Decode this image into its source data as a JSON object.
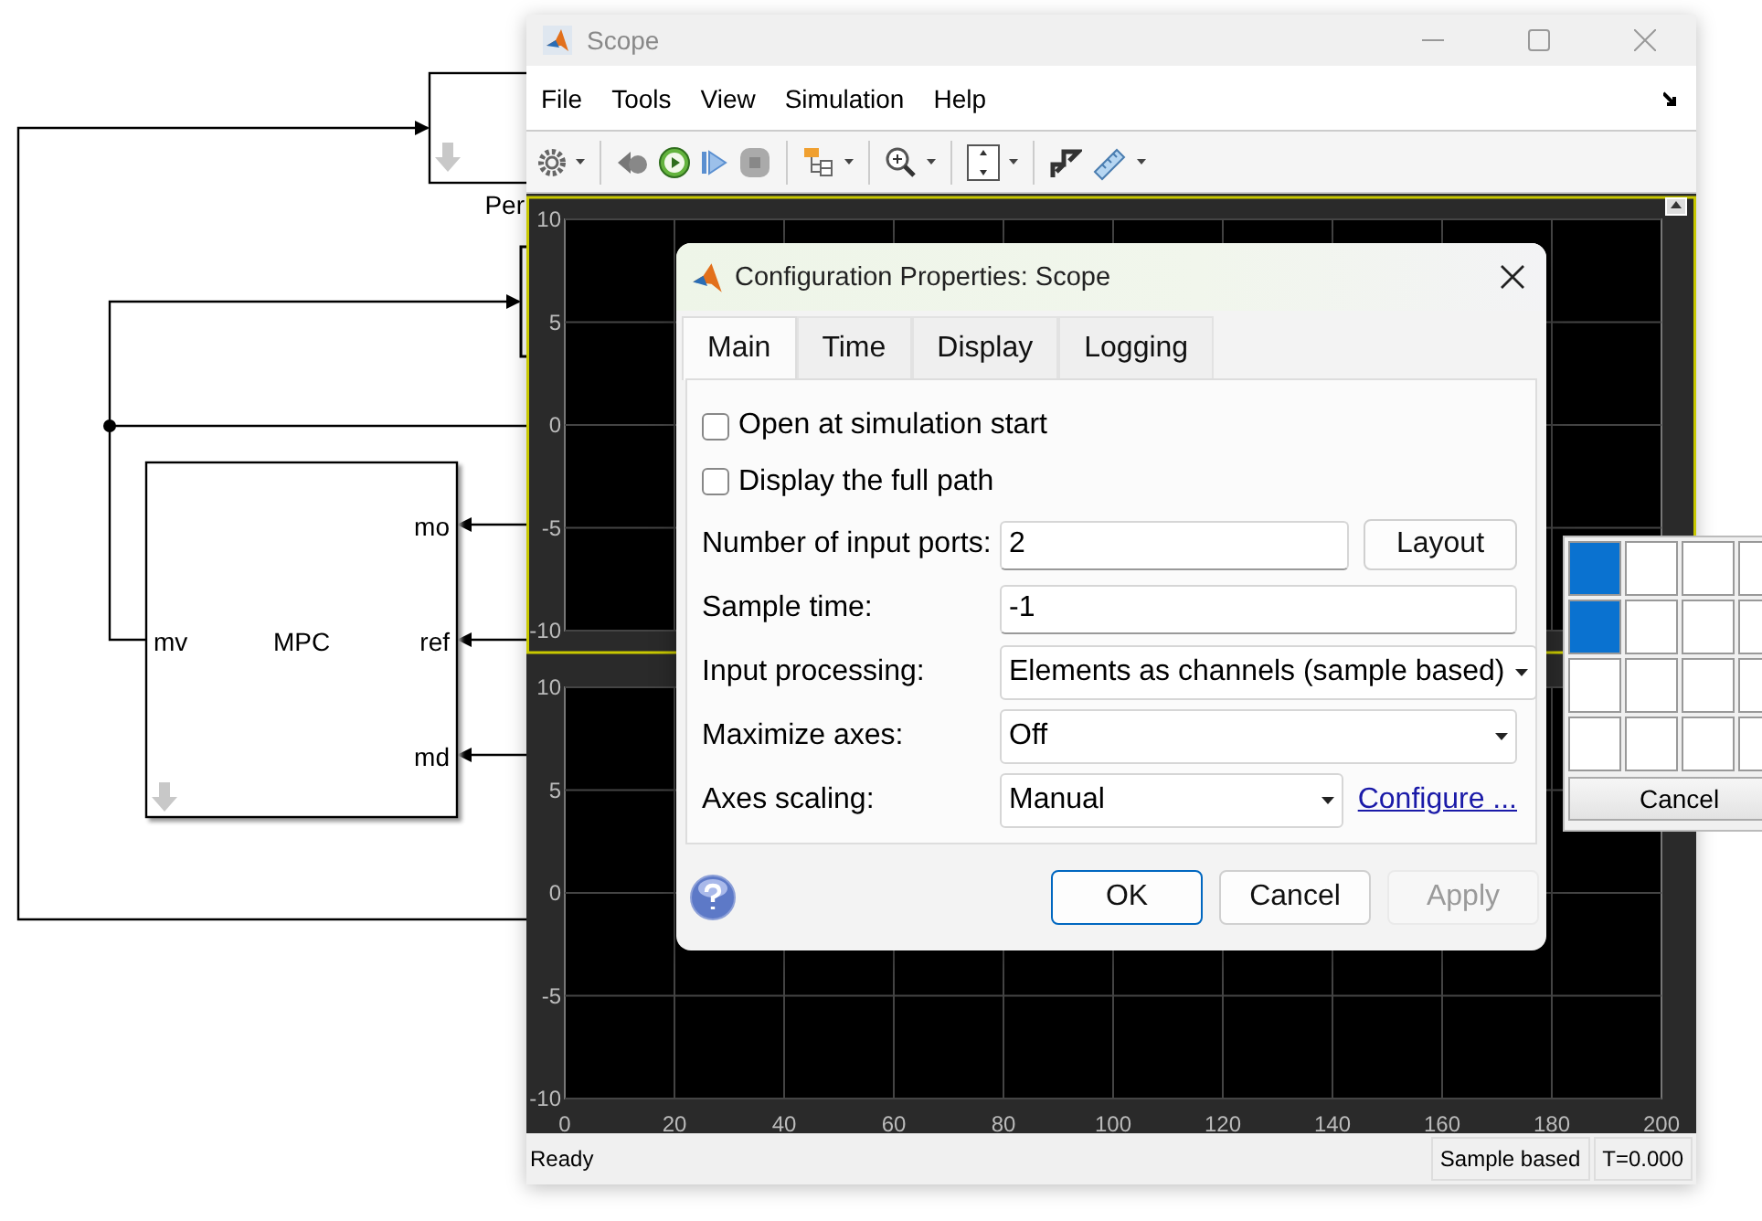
{
  "diagram": {
    "top_block_label": "Per",
    "mpc_block": {
      "name": "MPC",
      "left_ports": [
        "mv"
      ],
      "right_ports": [
        "mo",
        "ref",
        "md"
      ]
    }
  },
  "scope_window": {
    "title": "Scope",
    "menu": [
      "File",
      "Tools",
      "View",
      "Simulation",
      "Help"
    ],
    "axes": [
      {
        "selected": true,
        "yticks": [
          "10",
          "5",
          "0",
          "-5",
          "-10"
        ]
      },
      {
        "selected": false,
        "yticks": [
          "10",
          "5",
          "0",
          "-5",
          "-10"
        ],
        "xticks": [
          "0",
          "20",
          "40",
          "60",
          "80",
          "100",
          "120",
          "140",
          "160",
          "180",
          "200"
        ]
      }
    ],
    "status_bar": {
      "text": "Ready",
      "mode": "Sample based",
      "time": "T=0.000"
    }
  },
  "dialog": {
    "title": "Configuration Properties: Scope",
    "tabs": [
      {
        "label": "Main",
        "selected": true
      },
      {
        "label": "Time",
        "selected": false
      },
      {
        "label": "Display",
        "selected": false
      },
      {
        "label": "Logging",
        "selected": false
      }
    ],
    "checkboxes": [
      {
        "label": "Open at simulation start",
        "checked": false
      },
      {
        "label": "Display the full path",
        "checked": false
      }
    ],
    "fields": [
      {
        "kind": "text_with_button",
        "label": "Number of input ports:",
        "value": "2",
        "button": "Layout"
      },
      {
        "kind": "text",
        "label": "Sample time:",
        "value": "-1"
      },
      {
        "kind": "dropdown",
        "label": "Input processing:",
        "value": "Elements as channels (sample based)"
      },
      {
        "kind": "dropdown",
        "label": "Maximize axes:",
        "value": "Off"
      },
      {
        "kind": "dropdown_with_link",
        "label": "Axes scaling:",
        "value": "Manual",
        "link": "Configure ..."
      }
    ],
    "buttons": [
      {
        "label": "OK",
        "default": true,
        "disabled": false
      },
      {
        "label": "Cancel",
        "default": false,
        "disabled": false
      },
      {
        "label": "Apply",
        "default": false,
        "disabled": true
      }
    ]
  },
  "layout_popup": {
    "rows": [
      {
        "cells": [
          {
            "selected": true
          },
          {
            "selected": false
          },
          {
            "selected": false
          },
          {
            "selected": false
          }
        ]
      },
      {
        "cells": [
          {
            "selected": true
          },
          {
            "selected": false
          },
          {
            "selected": false
          },
          {
            "selected": false
          }
        ]
      },
      {
        "cells": [
          {
            "selected": false
          },
          {
            "selected": false
          },
          {
            "selected": false
          },
          {
            "selected": false
          }
        ]
      },
      {
        "cells": [
          {
            "selected": false
          },
          {
            "selected": false
          },
          {
            "selected": false
          },
          {
            "selected": false
          }
        ]
      }
    ],
    "cancel": "Cancel"
  }
}
